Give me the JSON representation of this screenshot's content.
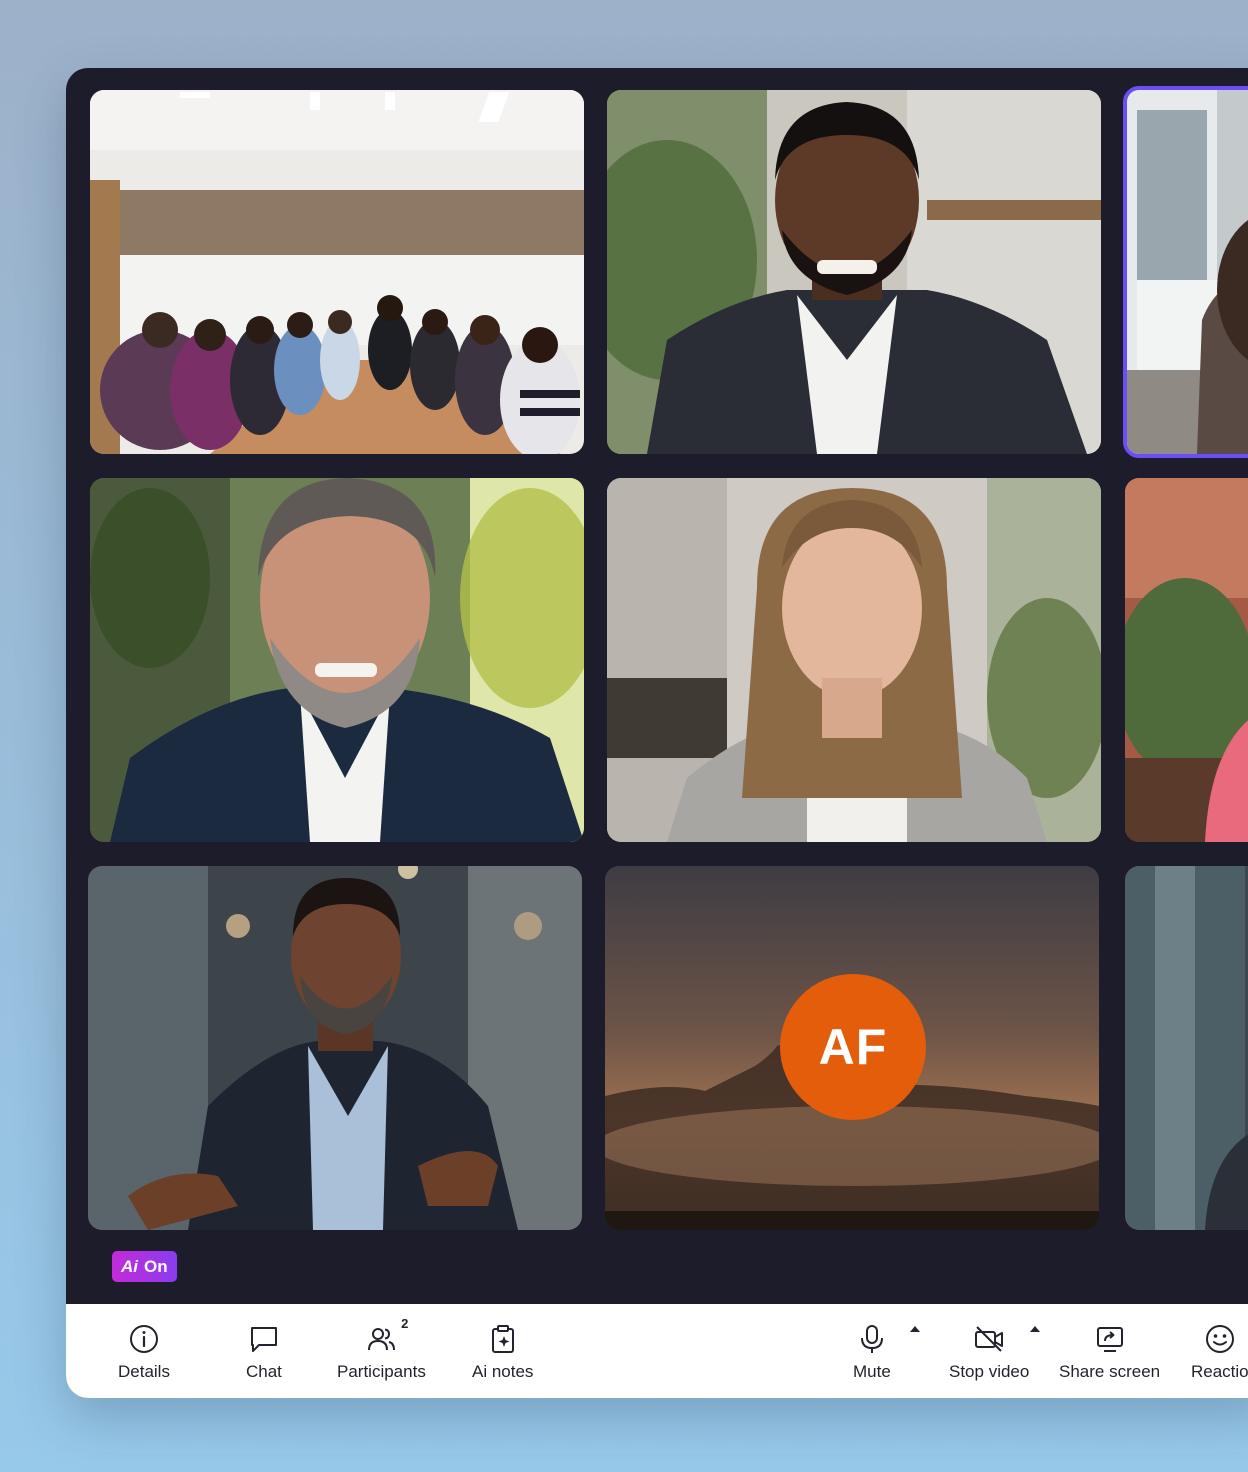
{
  "ai_badge": {
    "mark": "Ai",
    "label": "On"
  },
  "participants": {
    "avatar_initials": "AF",
    "avatar_color": "#e35d0b",
    "active_speaker_border": "#6b4ef6"
  },
  "toolbar": {
    "left": [
      {
        "label": "Details",
        "icon": "info-icon"
      },
      {
        "label": "Chat",
        "icon": "chat-icon"
      },
      {
        "label": "Participants",
        "icon": "participants-icon",
        "count": "2"
      },
      {
        "label": "Ai notes",
        "icon": "ai-notes-icon"
      }
    ],
    "right": [
      {
        "label": "Mute",
        "icon": "microphone-icon"
      },
      {
        "label": "Stop video",
        "icon": "video-off-icon"
      },
      {
        "label": "Share screen",
        "icon": "share-screen-icon"
      },
      {
        "label": "Reactio",
        "icon": "smiley-icon"
      }
    ]
  }
}
